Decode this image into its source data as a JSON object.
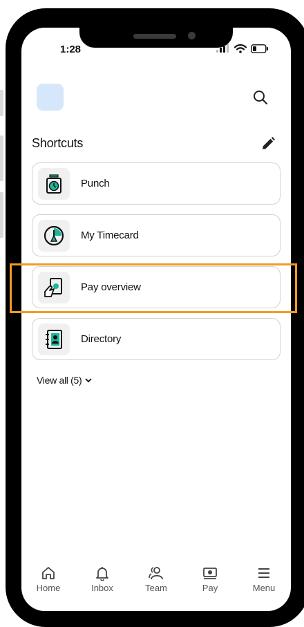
{
  "status_bar": {
    "time": "1:28"
  },
  "header": {
    "search_icon": "search-icon"
  },
  "shortcuts": {
    "title": "Shortcuts",
    "edit_icon": "pencil-icon",
    "items": [
      {
        "label": "Punch",
        "icon": "punch-clock-icon"
      },
      {
        "label": "My Timecard",
        "icon": "timecard-icon"
      },
      {
        "label": "Pay overview",
        "icon": "pay-overview-icon"
      },
      {
        "label": "Directory",
        "icon": "directory-icon"
      }
    ],
    "view_all_label": "View all (5)"
  },
  "bottom_nav": [
    {
      "label": "Home",
      "icon": "home-icon"
    },
    {
      "label": "Inbox",
      "icon": "bell-icon"
    },
    {
      "label": "Team",
      "icon": "team-icon"
    },
    {
      "label": "Pay",
      "icon": "pay-icon"
    },
    {
      "label": "Menu",
      "icon": "menu-icon"
    }
  ],
  "colors": {
    "accent": "#1fb59a",
    "highlight": "#f39a26",
    "avatar_bg": "#d7e7fb"
  }
}
